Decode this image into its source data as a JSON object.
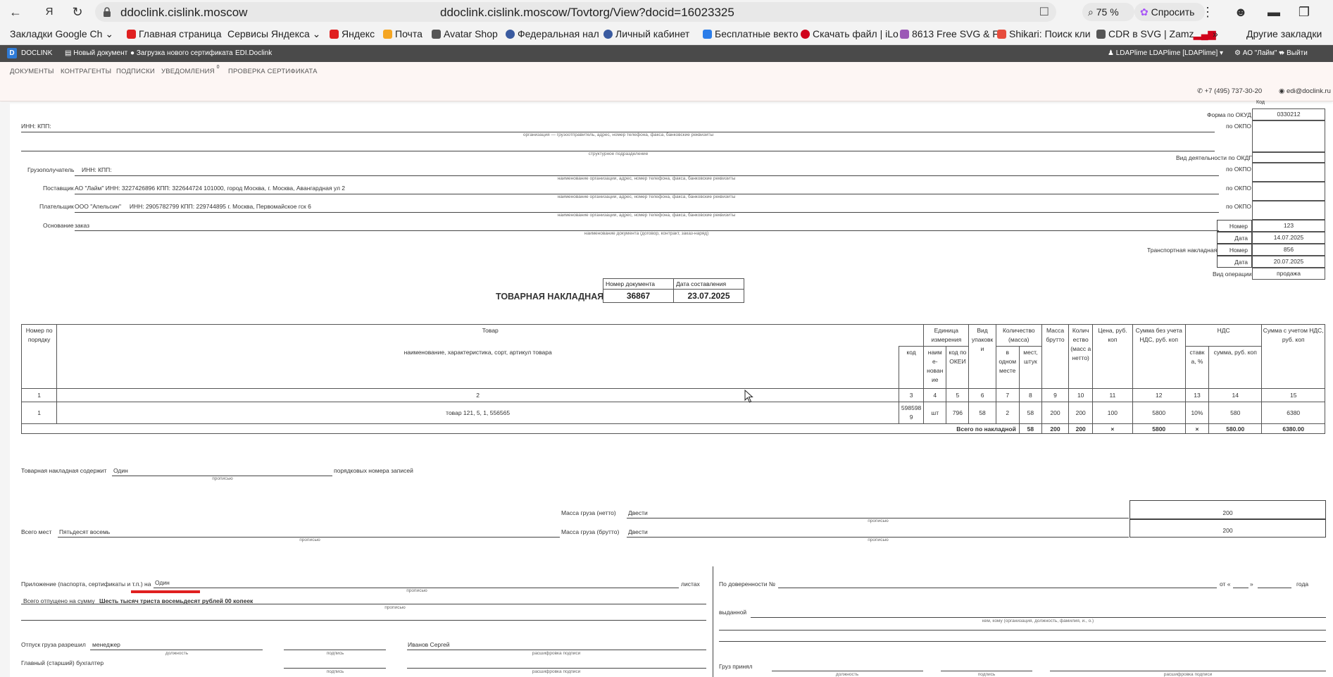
{
  "browser": {
    "domain": "ddoclink.cislink.moscow",
    "url": "ddoclink.cislink.moscow/Tovtorg/View?docid=16023325",
    "zoom": "75 %",
    "ask": "Спросить",
    "bookmarks": [
      {
        "label": "Закладки Google Ch",
        "color": "#4285f4"
      },
      {
        "label": "Главная страница",
        "color": "#e02020"
      },
      {
        "label": "Сервисы Яндекса",
        "color": "#f3f3f3"
      },
      {
        "label": "Яндекс",
        "color": "#e02020"
      },
      {
        "label": "Почта",
        "color": "#f5a623"
      },
      {
        "label": "Avatar Shop",
        "color": "#555555"
      },
      {
        "label": "Федеральная нал",
        "color": "#3a5ba0"
      },
      {
        "label": "Личный кабинет",
        "color": "#3a5ba0"
      },
      {
        "label": "Бесплатные векто",
        "color": "#e74c3c"
      },
      {
        "label": "Скачать файл | iLo",
        "color": "#d0021b"
      },
      {
        "label": "8613 Free SVG & F",
        "color": "#9b59b6"
      },
      {
        "label": "Shikari: Поиск кли",
        "color": "#e74c3c"
      },
      {
        "label": "CDR в SVG | Zamz",
        "color": "#555555"
      }
    ],
    "other_bookmarks": "Другие закладки"
  },
  "app": {
    "logo": "DOCLINK",
    "new_doc": "Новый документ",
    "upload_cert": "Загрузка нового сертификата",
    "edi": "EDI.Doclink",
    "user": "LDAPlime LDAPlime [LDAPlime]",
    "org": "АО \"Лайм\"",
    "logout": "Выйти",
    "nav": [
      "ДОКУМЕНТЫ",
      "КОНТРАГЕНТЫ",
      "ПОДПИСКИ",
      "УВЕДОМЛЕНИЯ",
      "ПРОВЕРКА СЕРТИФИКАТА"
    ],
    "notif_count": "0",
    "phone": "+7 (495) 737-30-20",
    "email": "edi@doclink.ru"
  },
  "header": {
    "code_label": "Код",
    "okud_label": "Форма по ОКУД",
    "okud_value": "0330212",
    "okpo_label": "по ОКПО",
    "inn_kpp": "ИНН: КПП:",
    "cap_org_sender": "организация — грузоотправитель, адрес, номер телефона, факса, банковские реквизиты",
    "cap_subdivision": "структурное подразделение",
    "okdp_label": "Вид деятельности по ОКДП",
    "consignee_label": "Грузополучатель",
    "consignee_value": "ИНН: КПП:",
    "cap_org": "наименование организации, адрес, номер телефона, факса, банковские реквизиты",
    "supplier_label": "Поставщик",
    "supplier_value": "АО \"Лайм\" ИНН: 3227426896 КПП: 322644724 101000, город Москва, г. Москва, Авангардная ул 2",
    "payer_label": "Плательщик",
    "payer_value": "ООО \"Апельсин\"     ИНН: 2905782799 КПП: 229744895 г. Москва, Первомайское гск 6",
    "basis_label": "Основание",
    "basis_value": "заказ",
    "cap_basis": "наименование документа (договор, контракт, заказ-наряд)",
    "number_label": "Номер",
    "number_value": "123",
    "date_label": "Дата",
    "date_value": "14.07.2025",
    "transport_label": "Транспортная накладная",
    "transport_number": "856",
    "transport_date": "20.07.2025",
    "op_label": "Вид операции",
    "op_value": "продажа"
  },
  "doc": {
    "title": "ТОВАРНАЯ НАКЛАДНАЯ",
    "num_label": "Номер документа",
    "date_label": "Дата составления",
    "num_value": "36867",
    "date_value": "23.07.2025"
  },
  "table": {
    "h_num": "Номер по порядку",
    "h_goods": "Товар",
    "h_goods_sub": "наименование, характеристика, сорт, артикул товара",
    "h_code": "код",
    "h_unit": "Единица измерения",
    "h_unit_name": "наим е-нован ие",
    "h_okei": "код по ОКЕИ",
    "h_pack": "Вид упаковк и",
    "h_qty": "Количество (масса)",
    "h_qty_one": "в одном месте",
    "h_qty_places": "мест, штук",
    "h_gross": "Масса брутто",
    "h_net": "Колич ество (масс а нетто)",
    "h_price": "Цена, руб. коп",
    "h_sum_novat": "Сумма без учета НДС, руб. коп",
    "h_vat": "НДС",
    "h_vat_rate": "ставк а, %",
    "h_vat_sum": "сумма, руб. коп",
    "h_sum_vat": "Сумма с учетом НДС, руб. коп",
    "col_numbers": [
      "1",
      "2",
      "3",
      "4",
      "5",
      "6",
      "7",
      "8",
      "9",
      "10",
      "11",
      "12",
      "13",
      "14",
      "15"
    ],
    "row": [
      "1",
      "товар 121, 5, 1, 556565",
      "5985989",
      "шт",
      "796",
      "58",
      "2",
      "58",
      "200",
      "200",
      "100",
      "5800",
      "10%",
      "580",
      "6380"
    ],
    "total_label": "Всего по накладной",
    "total": [
      "58",
      "200",
      "200",
      "×",
      "5800",
      "×",
      "580.00",
      "6380.00"
    ]
  },
  "footer": {
    "contains_label": "Товарная накладная содержит",
    "contains_value": "Один",
    "contains_suffix": "порядковых номера записей",
    "cap_words": "прописью",
    "net_label": "Масса груза (нетто)",
    "net_value": "Двести",
    "net_box": "200",
    "places_label": "Всего мест",
    "places_value": "Пятьдесят восемь",
    "gross_label": "Масса груза (брутто)",
    "gross_value": "Двести",
    "gross_box": "200",
    "attach_label": "Приложение (паспорта, сертификаты и т.п.) на",
    "attach_value": "Один",
    "attach_suffix": "листах",
    "released_sum_label": "Всего отпущено на сумму",
    "released_sum_value": "Шесть тысяч триста восемьдесят рублей 00 копеек",
    "release_allowed_label": "Отпуск груза разрешил",
    "release_position": "менеджер",
    "cap_position": "должность",
    "cap_signature": "подпись",
    "release_name": "Иванов  Сергей",
    "cap_decoding": "расшифровка подписи",
    "accountant_label": "Главный (старший) бухгалтер",
    "proxy_label": "По доверенности №",
    "proxy_from": "от «",
    "proxy_quote": "»",
    "proxy_year": "года",
    "issued_label": "выданной",
    "cap_issued": "кем, кому (организация, должность, фамилия, и., о.)",
    "accepted_label": "Груз принял"
  }
}
